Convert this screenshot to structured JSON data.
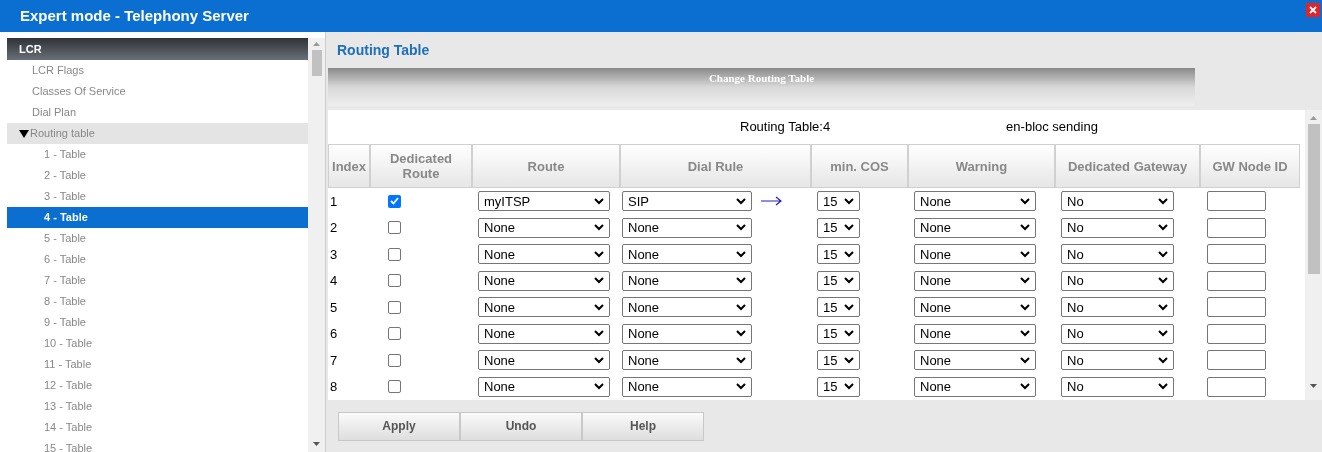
{
  "window": {
    "title": "Expert mode - Telephony Server"
  },
  "sidebar": {
    "header": "LCR",
    "items": [
      {
        "label": "LCR Flags",
        "selected": false
      },
      {
        "label": "Classes Of Service",
        "selected": false
      },
      {
        "label": "Dial Plan",
        "selected": false
      },
      {
        "label": "Routing table",
        "selected": false,
        "expanded": true,
        "children": [
          {
            "label": "1 - Table",
            "selected": false
          },
          {
            "label": "2 - Table",
            "selected": false
          },
          {
            "label": "3 - Table",
            "selected": false
          },
          {
            "label": "4 - Table",
            "selected": true
          },
          {
            "label": "5 - Table",
            "selected": false
          },
          {
            "label": "6 - Table",
            "selected": false
          },
          {
            "label": "7 - Table",
            "selected": false
          },
          {
            "label": "8 - Table",
            "selected": false
          },
          {
            "label": "9 - Table",
            "selected": false
          },
          {
            "label": "10 - Table",
            "selected": false
          },
          {
            "label": "11 - Table",
            "selected": false
          },
          {
            "label": "12 - Table",
            "selected": false
          },
          {
            "label": "13 - Table",
            "selected": false
          },
          {
            "label": "14 - Table",
            "selected": false
          },
          {
            "label": "15 - Table",
            "selected": false
          }
        ]
      }
    ]
  },
  "page": {
    "title": "Routing Table",
    "banner": "Change Routing Table",
    "table_label": "Routing Table:4",
    "mode": "en-bloc sending"
  },
  "table": {
    "columns": [
      "Index",
      "Dedicated Route",
      "Route",
      "Dial Rule",
      "min. COS",
      "Warning",
      "Dedicated Gateway",
      "GW Node ID"
    ],
    "rows": [
      {
        "index": "1",
        "dedicated": true,
        "route": "myITSP",
        "dial_rule": "SIP",
        "link": true,
        "min_cos": "15",
        "warning": "None",
        "gateway": "No"
      },
      {
        "index": "2",
        "dedicated": false,
        "route": "None",
        "dial_rule": "None",
        "link": false,
        "min_cos": "15",
        "warning": "None",
        "gateway": "No"
      },
      {
        "index": "3",
        "dedicated": false,
        "route": "None",
        "dial_rule": "None",
        "link": false,
        "min_cos": "15",
        "warning": "None",
        "gateway": "No"
      },
      {
        "index": "4",
        "dedicated": false,
        "route": "None",
        "dial_rule": "None",
        "link": false,
        "min_cos": "15",
        "warning": "None",
        "gateway": "No"
      },
      {
        "index": "5",
        "dedicated": false,
        "route": "None",
        "dial_rule": "None",
        "link": false,
        "min_cos": "15",
        "warning": "None",
        "gateway": "No"
      },
      {
        "index": "6",
        "dedicated": false,
        "route": "None",
        "dial_rule": "None",
        "link": false,
        "min_cos": "15",
        "warning": "None",
        "gateway": "No"
      },
      {
        "index": "7",
        "dedicated": false,
        "route": "None",
        "dial_rule": "None",
        "link": false,
        "min_cos": "15",
        "warning": "None",
        "gateway": "No"
      },
      {
        "index": "8",
        "dedicated": false,
        "route": "None",
        "dial_rule": "None",
        "link": false,
        "min_cos": "15",
        "warning": "None",
        "gateway": "No"
      }
    ]
  },
  "buttons": [
    "Apply",
    "Undo",
    "Help"
  ]
}
